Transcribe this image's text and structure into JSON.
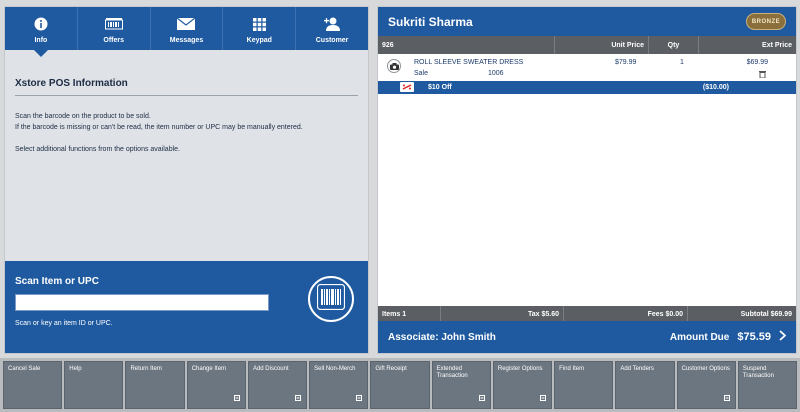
{
  "tabs": [
    {
      "label": "Info",
      "icon": "info-icon",
      "active": true
    },
    {
      "label": "Offers",
      "icon": "offers-icon",
      "active": false
    },
    {
      "label": "Messages",
      "icon": "envelope-icon",
      "active": false
    },
    {
      "label": "Keypad",
      "icon": "keypad-icon",
      "active": false
    },
    {
      "label": "Customer",
      "icon": "add-customer-icon",
      "active": false
    }
  ],
  "info": {
    "title": "Xstore POS Information",
    "line1": "Scan the barcode on the product to be sold.",
    "line2": "If the barcode is missing or can't be read, the item number or UPC may be manually entered.",
    "line3": "Select additional functions from the options available."
  },
  "scan": {
    "title": "Scan Item or UPC",
    "value": "",
    "hint": "Scan or key an item ID or UPC."
  },
  "customer": {
    "name": "Sukriti Sharma",
    "badge": "BRONZE"
  },
  "columns": {
    "id": "926",
    "unit_price": "Unit Price",
    "qty": "Qty",
    "ext_price": "Ext Price"
  },
  "item": {
    "description": "ROLL SLEEVE SWEATER DRESS",
    "type": "Sale",
    "code": "1006",
    "unit_price": "$79.99",
    "qty": "1",
    "ext_price": "$69.99"
  },
  "discount": {
    "label": "$10 Off",
    "amount": "($10.00)"
  },
  "totals": {
    "items": "Items 1",
    "tax": "Tax $5.60",
    "fees": "Fees $0.00",
    "subtotal": "Subtotal $69.99"
  },
  "footer": {
    "associate": "Associate: John Smith",
    "amount_label": "Amount Due",
    "amount_value": "$75.59"
  },
  "actions": [
    {
      "label": "Cancel Sale",
      "sub": false
    },
    {
      "label": "Help",
      "sub": false
    },
    {
      "label": "Return Item",
      "sub": false
    },
    {
      "label": "Change Item",
      "sub": true
    },
    {
      "label": "Add Discount",
      "sub": true
    },
    {
      "label": "Sell Non-Merch",
      "sub": true
    },
    {
      "label": "Gift Receipt",
      "sub": false
    },
    {
      "label": "Extended Transaction",
      "sub": true
    },
    {
      "label": "Register Options",
      "sub": true
    },
    {
      "label": "Find Item",
      "sub": false
    },
    {
      "label": "Add Tenders",
      "sub": false
    },
    {
      "label": "Customer Options",
      "sub": true
    },
    {
      "label": "Suspend Transaction",
      "sub": false
    }
  ],
  "colors": {
    "primary": "#1f5aa0",
    "header_gray": "#5b5e63",
    "button_gray": "#6c7680"
  }
}
